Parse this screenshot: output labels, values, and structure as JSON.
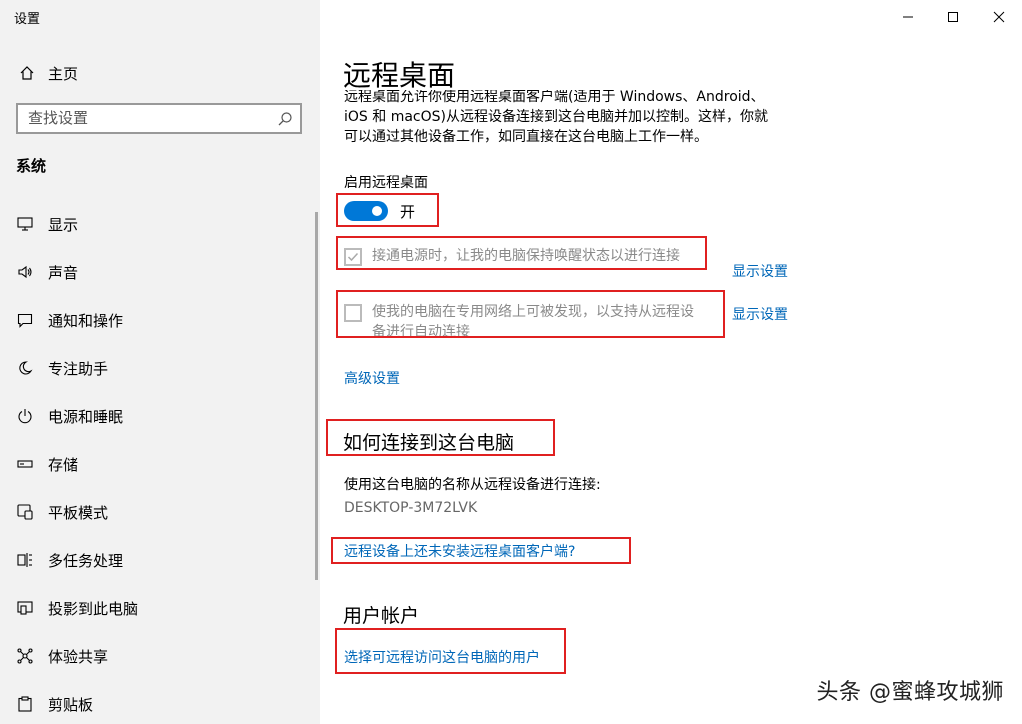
{
  "window": {
    "title": "设置"
  },
  "sidebar": {
    "home_label": "主页",
    "search_placeholder": "查找设置",
    "section_title": "系统",
    "items": [
      {
        "label": "显示",
        "icon": "display-icon"
      },
      {
        "label": "声音",
        "icon": "sound-icon"
      },
      {
        "label": "通知和操作",
        "icon": "notification-icon"
      },
      {
        "label": "专注助手",
        "icon": "moon-icon"
      },
      {
        "label": "电源和睡眠",
        "icon": "power-icon"
      },
      {
        "label": "存储",
        "icon": "storage-icon"
      },
      {
        "label": "平板模式",
        "icon": "tablet-icon"
      },
      {
        "label": "多任务处理",
        "icon": "multitask-icon"
      },
      {
        "label": "投影到此电脑",
        "icon": "project-icon"
      },
      {
        "label": "体验共享",
        "icon": "share-icon"
      },
      {
        "label": "剪贴板",
        "icon": "clipboard-icon"
      }
    ]
  },
  "main": {
    "title": "远程桌面",
    "description": [
      "远程桌面允许你使用远程桌面客户端(适用于 Windows、Android、",
      "iOS 和 macOS)从远程设备连接到这台电脑并加以控制。这样，你就",
      "可以通过其他设备工作，如同直接在这台电脑上工作一样。"
    ],
    "enable_label": "启用远程桌面",
    "toggle_state": "开",
    "toggle_on": true,
    "checkbox1": {
      "label": "接通电源时，让我的电脑保持唤醒状态以进行连接",
      "checked": true,
      "link": "显示设置"
    },
    "checkbox2": {
      "label_line1": "使我的电脑在专用网络上可被发现，以支持从远程设",
      "label_line2": "备进行自动连接",
      "checked": false,
      "link": "显示设置"
    },
    "advanced_link": "高级设置",
    "connect_heading": "如何连接到这台电脑",
    "connect_text": "使用这台电脑的名称从远程设备进行连接:",
    "pc_name": "DESKTOP-3M72LVK",
    "client_link": "远程设备上还未安装远程桌面客户端?",
    "accounts_heading": "用户帐户",
    "users_link": "选择可远程访问这台电脑的用户"
  },
  "watermark": "头条 @蜜蜂攻城狮",
  "colors": {
    "accent": "#0078d7",
    "link": "#0067b8",
    "highlight_box": "#e02020"
  }
}
